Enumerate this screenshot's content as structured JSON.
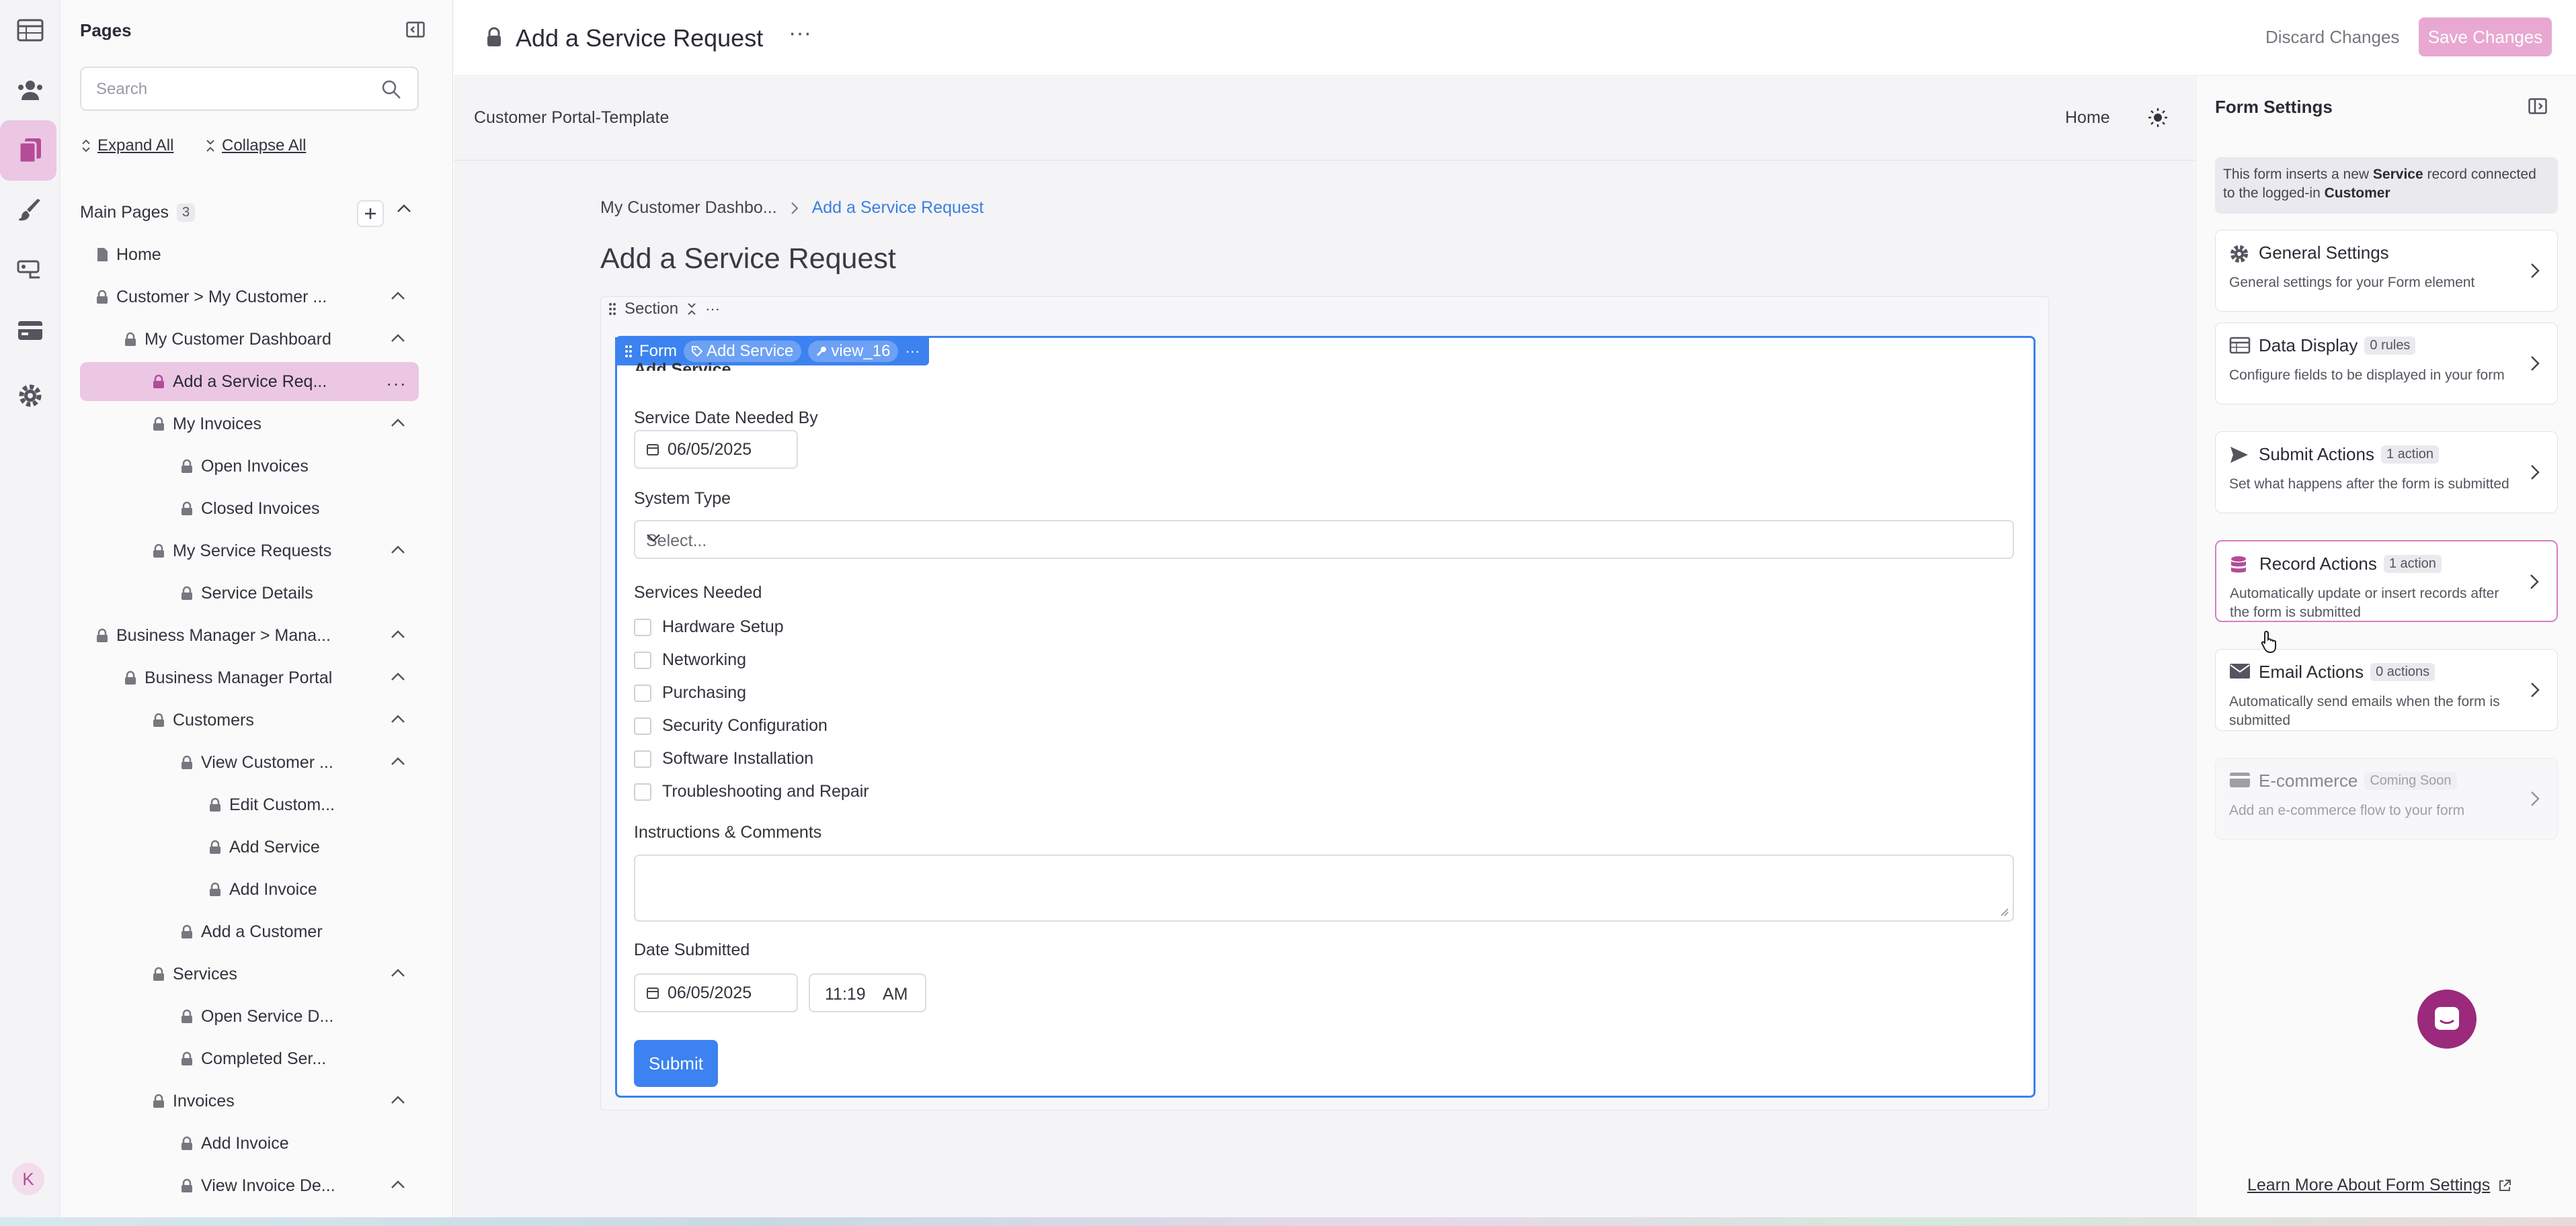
{
  "rail": {
    "items": [
      {
        "name": "tables-icon"
      },
      {
        "name": "users-icon"
      },
      {
        "name": "pages-icon"
      },
      {
        "name": "brush-icon"
      },
      {
        "name": "flows-icon"
      },
      {
        "name": "payments-icon"
      },
      {
        "name": "gear-icon"
      }
    ],
    "active_index": 2,
    "avatar": "K"
  },
  "pages_panel": {
    "title": "Pages",
    "search_placeholder": "Search",
    "expand_all": "Expand All",
    "collapse_all": "Collapse All",
    "main_pages_label": "Main Pages",
    "main_pages_count": "3",
    "tree": [
      {
        "label": "Home",
        "depth": 0,
        "icon": "page",
        "chevron": false
      },
      {
        "label": "Customer > My Customer ...",
        "depth": 0,
        "icon": "lock",
        "chevron": true
      },
      {
        "label": "My Customer Dashboard",
        "depth": 1,
        "icon": "lock",
        "chevron": true
      },
      {
        "label": "Add a Service Req...",
        "depth": 2,
        "icon": "lock-pink",
        "chevron": false,
        "selected": true
      },
      {
        "label": "My Invoices",
        "depth": 2,
        "icon": "lock",
        "chevron": true
      },
      {
        "label": "Open Invoices",
        "depth": 3,
        "icon": "lock",
        "chevron": false
      },
      {
        "label": "Closed Invoices",
        "depth": 3,
        "icon": "lock",
        "chevron": false
      },
      {
        "label": "My Service Requests",
        "depth": 2,
        "icon": "lock",
        "chevron": true
      },
      {
        "label": "Service Details",
        "depth": 3,
        "icon": "lock",
        "chevron": false
      },
      {
        "label": "Business Manager > Mana...",
        "depth": 0,
        "icon": "lock",
        "chevron": true
      },
      {
        "label": "Business Manager Portal",
        "depth": 1,
        "icon": "lock",
        "chevron": true
      },
      {
        "label": "Customers",
        "depth": 2,
        "icon": "lock",
        "chevron": true
      },
      {
        "label": "View Customer ...",
        "depth": 3,
        "icon": "lock",
        "chevron": true
      },
      {
        "label": "Edit Custom...",
        "depth": 4,
        "icon": "lock",
        "chevron": false
      },
      {
        "label": "Add Service",
        "depth": 4,
        "icon": "lock",
        "chevron": false
      },
      {
        "label": "Add Invoice",
        "depth": 4,
        "icon": "lock",
        "chevron": false
      },
      {
        "label": "Add a Customer",
        "depth": 3,
        "icon": "lock",
        "chevron": false
      },
      {
        "label": "Services",
        "depth": 2,
        "icon": "lock",
        "chevron": true
      },
      {
        "label": "Open Service D...",
        "depth": 3,
        "icon": "lock",
        "chevron": false
      },
      {
        "label": "Completed Ser...",
        "depth": 3,
        "icon": "lock",
        "chevron": false
      },
      {
        "label": "Invoices",
        "depth": 2,
        "icon": "lock",
        "chevron": true
      },
      {
        "label": "Add Invoice",
        "depth": 3,
        "icon": "lock",
        "chevron": false
      },
      {
        "label": "View Invoice De...",
        "depth": 3,
        "icon": "lock",
        "chevron": true
      }
    ]
  },
  "topbar": {
    "title": "Add a Service Request",
    "more": "···",
    "discard": "Discard Changes",
    "save": "Save Changes"
  },
  "canvas": {
    "portal_name": "Customer Portal-Template",
    "nav_home": "Home",
    "breadcrumb": [
      "My Customer Dashbo...",
      "Add a Service Request"
    ],
    "page_heading": "Add a Service Request",
    "section_tag": "Section",
    "form_tag": {
      "label": "Form",
      "source": "Add Service",
      "view": "view_16"
    },
    "form": {
      "heading": "Add Service",
      "service_date_label": "Service Date Needed By",
      "service_date_value": "06/05/2025",
      "system_type_label": "System Type",
      "system_type_placeholder": "Select...",
      "services_label": "Services Needed",
      "services": [
        "Hardware Setup",
        "Networking",
        "Purchasing",
        "Security Configuration",
        "Software Installation",
        "Troubleshooting and Repair"
      ],
      "comments_label": "Instructions & Comments",
      "date_submitted_label": "Date Submitted",
      "date_submitted_value": "06/05/2025",
      "time_value": "11:19",
      "ampm": "AM",
      "submit": "Submit"
    }
  },
  "settings": {
    "title": "Form Settings",
    "info": {
      "pre": "This form inserts a new ",
      "b1": "Service",
      "mid": " record connected to the logged-in ",
      "b2": "Customer"
    },
    "cards": [
      {
        "title": "General Settings",
        "badge": "",
        "desc": "General settings for your Form element",
        "icon": "gear-icon"
      },
      {
        "title": "Data Display",
        "badge": "0 rules",
        "desc": "Configure fields to be displayed in your form",
        "icon": "table-icon"
      },
      {
        "title": "Submit Actions",
        "badge": "1 action",
        "desc": "Set what happens after the form is submitted",
        "icon": "send-icon"
      },
      {
        "title": "Record Actions",
        "badge": "1 action",
        "desc": "Automatically update or insert records after the form is submitted",
        "icon": "database-icon",
        "active": true
      },
      {
        "title": "Email Actions",
        "badge": "0 actions",
        "desc": "Automatically send emails when the form is submitted",
        "icon": "mail-icon"
      },
      {
        "title": "E-commerce",
        "badge": "Coming Soon",
        "desc": "Add an e-commerce flow to your form",
        "icon": "card-icon",
        "disabled": true
      }
    ],
    "learn_more": "Learn More About Form Settings"
  },
  "colors": {
    "accent": "#3c82f0",
    "brand": "#b44c98",
    "selected": "#ebc7e4",
    "save_disabled": "#e8a8d2"
  }
}
